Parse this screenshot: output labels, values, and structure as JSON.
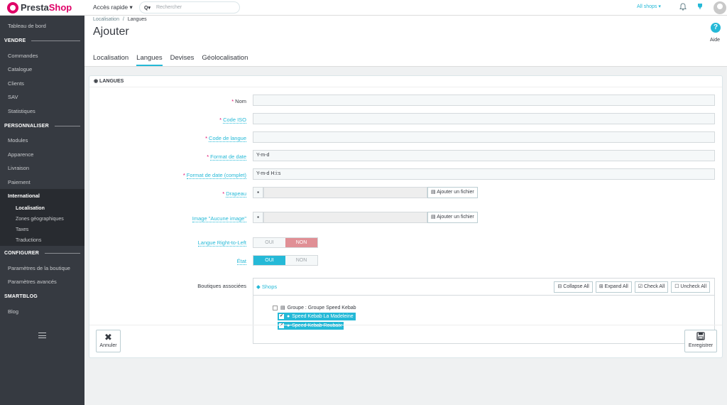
{
  "logo": {
    "part1": "Presta",
    "part2": "Shop"
  },
  "sidebar": {
    "items_top": [
      "Tableau de bord"
    ],
    "section_vendre": "VENDRE",
    "vendre": [
      "Commandes",
      "Catalogue",
      "Clients",
      "SAV",
      "Statistiques"
    ],
    "section_personnaliser": "PERSONNALISER",
    "personnaliser": [
      "Modules",
      "Apparence",
      "Livraison",
      "Paiement"
    ],
    "international": "International",
    "international_sub": [
      "Localisation",
      "Zones géographiques",
      "Taxes",
      "Traductions"
    ],
    "section_configurer": "CONFIGURER",
    "configurer": [
      "Paramètres de la boutique",
      "Paramètres avancés"
    ],
    "section_smartblog": "SMARTBLOG",
    "smartblog": [
      "Blog"
    ]
  },
  "topbar": {
    "quick_access": "Accès rapide ▾",
    "search_icon": "Q▾",
    "search_placeholder": "Rechercher",
    "shops": "All shops ▾"
  },
  "header": {
    "breadcrumb_parent": "Localisation",
    "breadcrumb_sep": "/",
    "breadcrumb_current": "Langues",
    "title": "Ajouter",
    "help_icon": "?",
    "help_label": "Aide"
  },
  "tabs": [
    "Localisation",
    "Langues",
    "Devises",
    "Géolocalisation"
  ],
  "panel": {
    "heading": "◉ LANGUES",
    "fields": {
      "nom": {
        "label": "Nom",
        "value": ""
      },
      "iso": {
        "label": "Code ISO",
        "value": ""
      },
      "lang_code": {
        "label": "Code de langue",
        "value": ""
      },
      "date_format": {
        "label": "Format de date",
        "value": "Y-m-d"
      },
      "date_format_full": {
        "label": "Format de date (complet)",
        "value": "Y-m-d H:i:s"
      },
      "flag": {
        "label": "Drapeau",
        "button": "Ajouter un fichier"
      },
      "no_image": {
        "label": "Image \"Aucune image\"",
        "button": "Ajouter un fichier"
      },
      "rtl": {
        "label": "Langue Right-to-Left",
        "yes": "OUI",
        "no": "NON"
      },
      "state": {
        "label": "État",
        "yes": "OUI",
        "no": "NON"
      },
      "shops": {
        "label": "Boutiques associées"
      }
    },
    "tree": {
      "title": "Shops",
      "collapse": "Collapse All",
      "expand": "Expand All",
      "check": "Check All",
      "uncheck": "Uncheck All",
      "group": "Groupe : Groupe Speed Kebab",
      "shop1": "Speed Kebab La Madeleine",
      "shop2": "Speed Kebab Roubaix"
    },
    "footer": {
      "cancel": "Annuler",
      "save": "Enregistrer"
    }
  }
}
